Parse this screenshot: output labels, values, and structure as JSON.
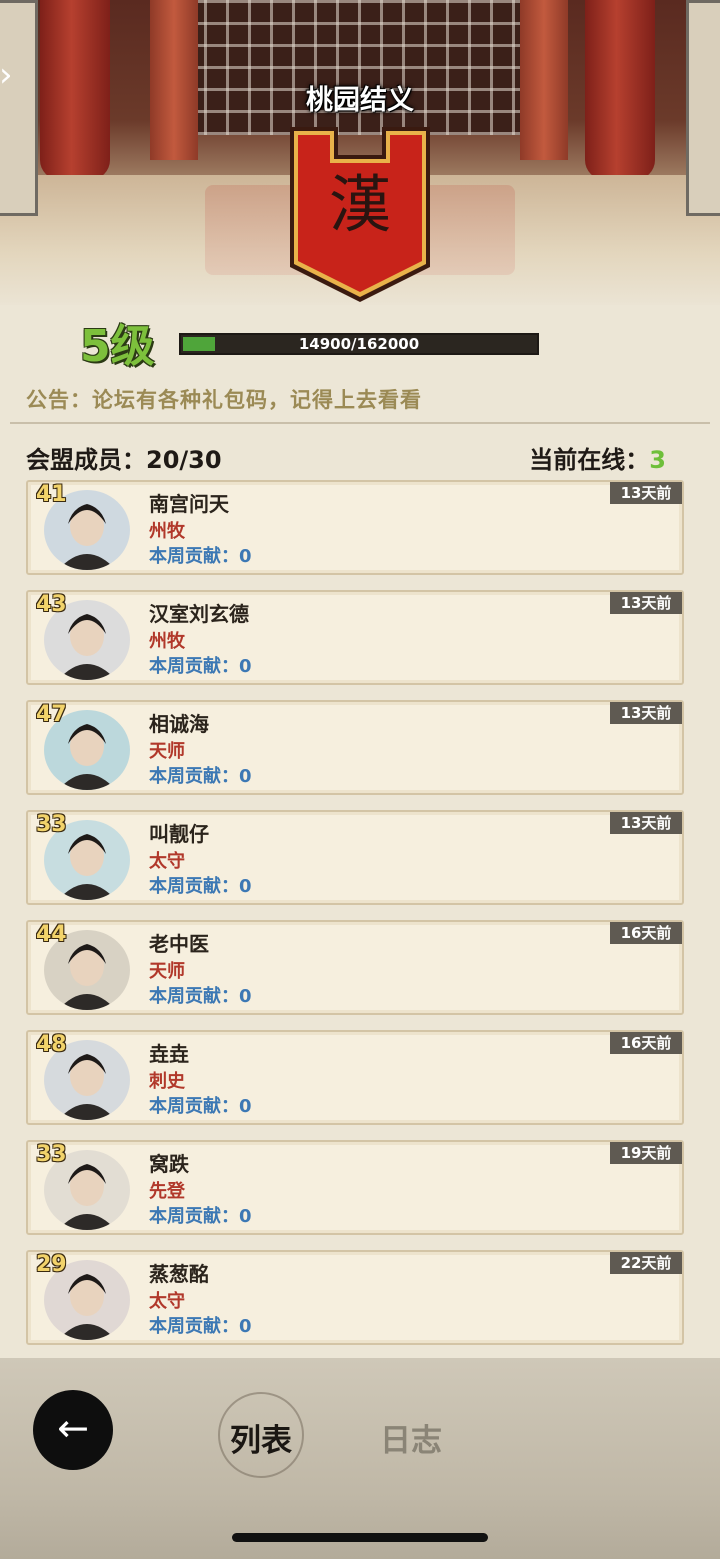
{
  "guild": {
    "name": "桃园结义",
    "emblem": "漢"
  },
  "level": {
    "label": "5级",
    "xp_text": "14900/162000",
    "progress": 0.092
  },
  "notice": "公告：论坛有各种礼包码，记得上去看看",
  "members_header": {
    "label": "会盟成员：",
    "count": "20/30",
    "online_label": "当前在线：",
    "online_count": "3"
  },
  "members": [
    {
      "level": "41",
      "name": "南宫问天",
      "title": "州牧",
      "contribution": "本周贡献：0",
      "last_seen": "13天前"
    },
    {
      "level": "43",
      "name": "汉室刘玄德",
      "title": "州牧",
      "contribution": "本周贡献：0",
      "last_seen": "13天前"
    },
    {
      "level": "47",
      "name": "相诚海",
      "title": "天师",
      "contribution": "本周贡献：0",
      "last_seen": "13天前"
    },
    {
      "level": "33",
      "name": "叫靓仔",
      "title": "太守",
      "contribution": "本周贡献：0",
      "last_seen": "13天前"
    },
    {
      "level": "44",
      "name": "老中医",
      "title": "天师",
      "contribution": "本周贡献：0",
      "last_seen": "16天前"
    },
    {
      "level": "48",
      "name": "垚垚",
      "title": "刺史",
      "contribution": "本周贡献：0",
      "last_seen": "16天前"
    },
    {
      "level": "33",
      "name": "窝跌",
      "title": "先登",
      "contribution": "本周贡献：0",
      "last_seen": "19天前"
    },
    {
      "level": "29",
      "name": "蒸葱酩",
      "title": "太守",
      "contribution": "本周贡献：0",
      "last_seen": "22天前"
    }
  ],
  "tabs": {
    "list": "列表",
    "log": "日志"
  },
  "icons": {
    "back": "back-arrow-icon",
    "side": "chevron-right-icon",
    "avatar": "portrait-icon"
  },
  "colors": {
    "accent_green": "#7dc03c",
    "banner_red": "#c8231a",
    "title_red": "#b1382a",
    "contrib_blue": "#3c78b4"
  }
}
